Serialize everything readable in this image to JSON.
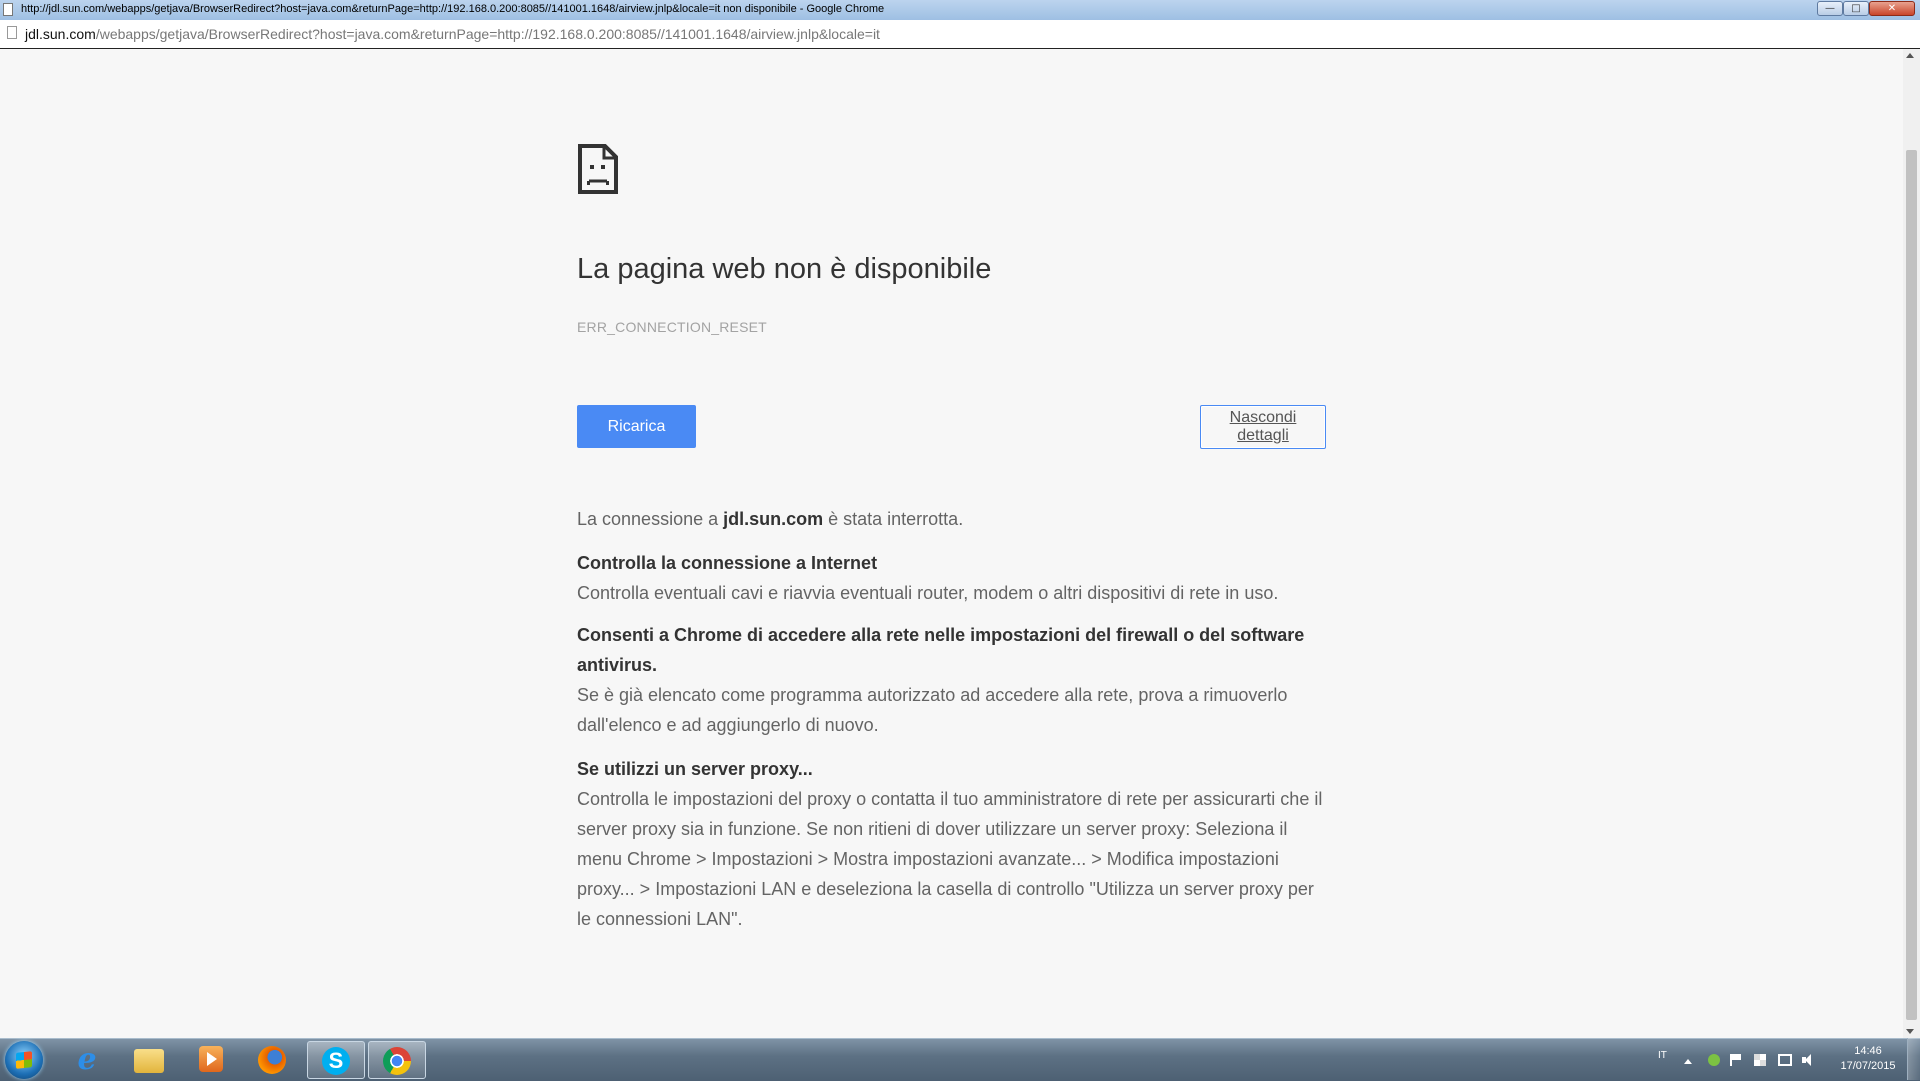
{
  "window": {
    "title": "http://jdl.sun.com/webapps/getjava/BrowserRedirect?host=java.com&returnPage=http://192.168.0.200:8085//141001.1648/airview.jnlp&locale=it non disponibile - Google Chrome",
    "controls": {
      "minimize": "—",
      "maximize": "□",
      "close": "✕"
    }
  },
  "address_bar": {
    "host": "jdl.sun.com",
    "path": "/webapps/getjava/BrowserRedirect?host=java.com&returnPage=http://192.168.0.200:8085//141001.1648/airview.jnlp&locale=it"
  },
  "error_page": {
    "icon": "sad-document-icon",
    "headline": "La pagina web non è disponibile",
    "error_code": "ERR_CONNECTION_RESET",
    "reload_label": "Ricarica",
    "details_label": "Nascondi dettagli",
    "intro_before": "La connessione a ",
    "intro_host": "jdl.sun.com",
    "intro_after": " è stata interrotta.",
    "sections": [
      {
        "heading": "Controlla la connessione a Internet",
        "body": "Controlla eventuali cavi e riavvia eventuali router, modem o altri dispositivi di rete in uso."
      },
      {
        "heading": "Consenti a Chrome di accedere alla rete nelle impostazioni del firewall o del software antivirus.",
        "body": "Se è già elencato come programma autorizzato ad accedere alla rete, prova a rimuoverlo dall'elenco e ad aggiungerlo di nuovo."
      },
      {
        "heading": "Se utilizzi un server proxy...",
        "body": "Controlla le impostazioni del proxy o contatta il tuo amministratore di rete per assicurarti che il server proxy sia in funzione. Se non ritieni di dover utilizzare un server proxy: Seleziona il menu Chrome > Impostazioni > Mostra impostazioni avanzate... > Modifica impostazioni proxy... > Impostazioni LAN e deseleziona la casella di controllo \"Utilizza un server proxy per le connessioni LAN\"."
      }
    ]
  },
  "taskbar": {
    "pinned": [
      {
        "name": "internet-explorer-icon",
        "glyph": "e"
      },
      {
        "name": "windows-explorer-icon"
      },
      {
        "name": "media-player-icon"
      },
      {
        "name": "firefox-icon"
      },
      {
        "name": "skype-icon",
        "glyph": "S"
      },
      {
        "name": "chrome-icon"
      }
    ],
    "tray": {
      "language": "IT",
      "time": "14:46",
      "date": "17/07/2015"
    }
  },
  "colors": {
    "accent": "#4a8af4",
    "page_bg": "#f7f7f7"
  }
}
